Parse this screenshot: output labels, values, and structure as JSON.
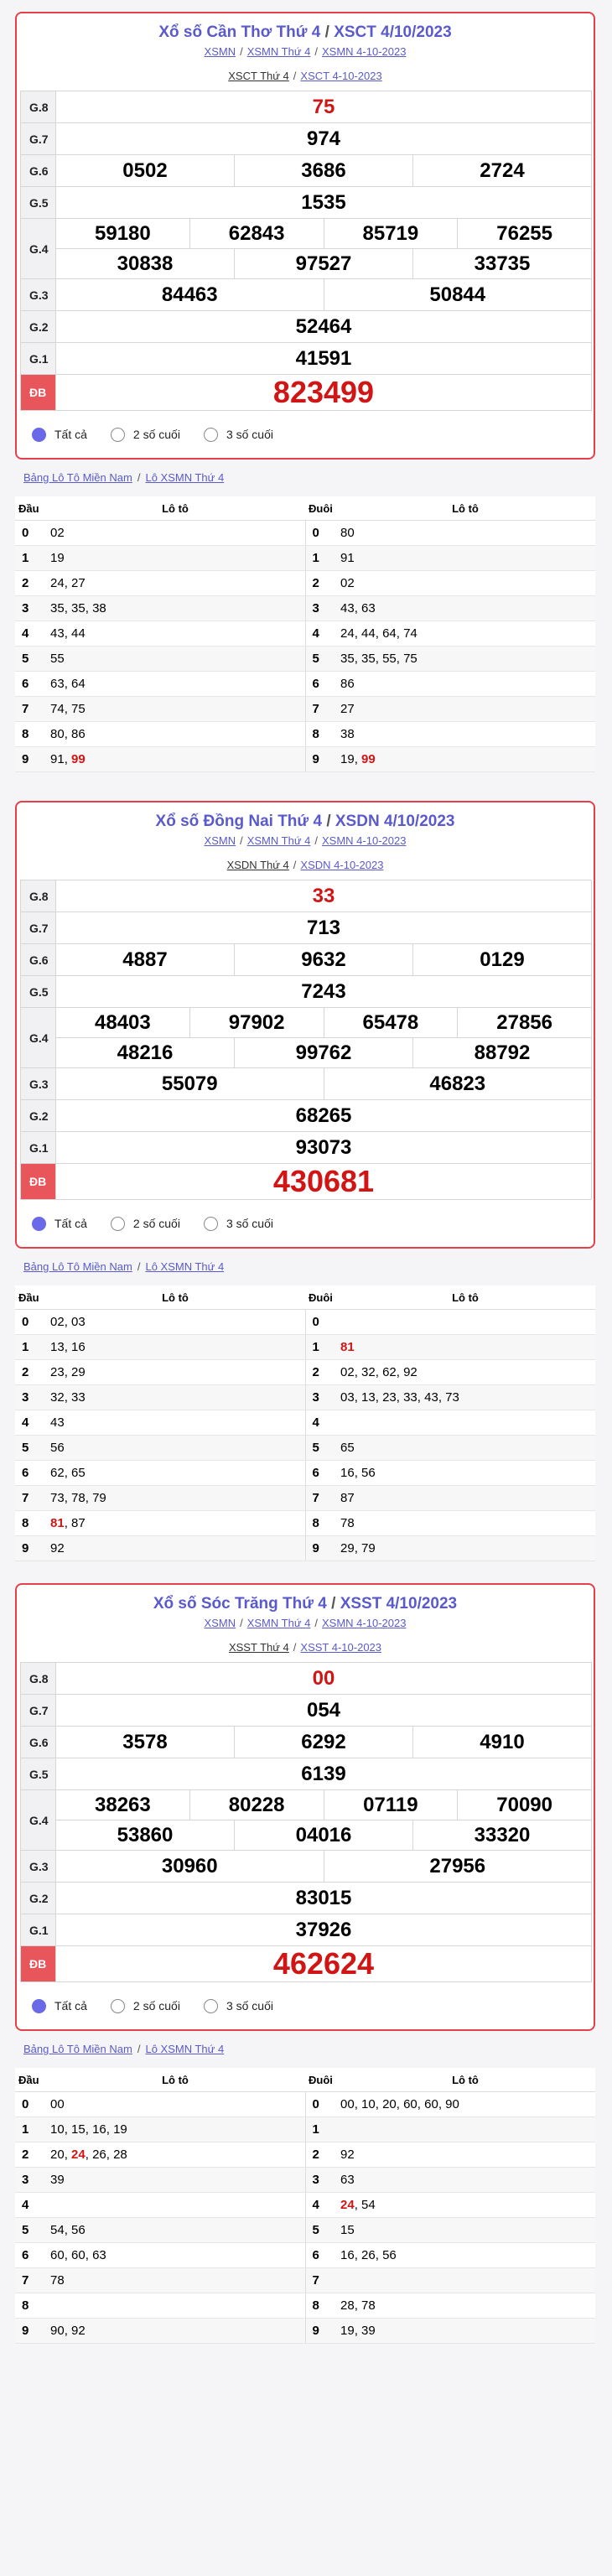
{
  "labels": {
    "prizes": [
      "G.8",
      "G.7",
      "G.6",
      "G.5",
      "G.4",
      "G.3",
      "G.2",
      "G.1",
      "ĐB"
    ],
    "options": [
      "Tất cả",
      "2 số cuối",
      "3 số cuối"
    ],
    "lo_head": [
      "Đầu",
      "Lô tô",
      "Đuôi",
      "Lô tô"
    ]
  },
  "sections": [
    {
      "title_main": "Xổ số Cần Thơ",
      "title_day": "Thứ 4",
      "title_code": "XSCT 4/10/2023",
      "links": [
        "XSMN",
        "XSMN Thứ 4",
        "XSMN 4-10-2023"
      ],
      "sublinks": [
        "XSCT Thứ 4",
        "XSCT 4-10-2023"
      ],
      "g8": "75",
      "g7": "974",
      "g6": [
        "0502",
        "3686",
        "2724"
      ],
      "g5": "1535",
      "g4": [
        "59180",
        "62843",
        "85719",
        "76255",
        "30838",
        "97527",
        "33735"
      ],
      "g3": [
        "84463",
        "50844"
      ],
      "g2": "52464",
      "g1": "41591",
      "db": "823499",
      "lo_links": [
        "Bảng Lô Tô Miền Nam",
        "Lô XSMN Thứ 4"
      ],
      "dau": [
        "02",
        "19",
        "24, 27",
        "35, 35, 38",
        "43, 44",
        "55",
        "63, 64",
        "74, 75",
        "80, 86",
        "91, 99"
      ],
      "duoi": [
        "80",
        "91",
        "02",
        "43, 63",
        "24, 44, 64, 74",
        "35, 35, 55, 75",
        "86",
        "27",
        "38",
        "19, 99"
      ]
    },
    {
      "title_main": "Xổ số Đồng Nai",
      "title_day": "Thứ 4",
      "title_code": "XSDN 4/10/2023",
      "links": [
        "XSMN",
        "XSMN Thứ 4",
        "XSMN 4-10-2023"
      ],
      "sublinks": [
        "XSDN Thứ 4",
        "XSDN 4-10-2023"
      ],
      "g8": "33",
      "g7": "713",
      "g6": [
        "4887",
        "9632",
        "0129"
      ],
      "g5": "7243",
      "g4": [
        "48403",
        "97902",
        "65478",
        "27856",
        "48216",
        "99762",
        "88792"
      ],
      "g3": [
        "55079",
        "46823"
      ],
      "g2": "68265",
      "g1": "93073",
      "db": "430681",
      "lo_links": [
        "Bảng Lô Tô Miền Nam",
        "Lô XSMN Thứ 4"
      ],
      "dau": [
        "02, 03",
        "13, 16",
        "23, 29",
        "32, 33",
        "43",
        "56",
        "62, 65",
        "73, 78, 79",
        "81, 87",
        "92"
      ],
      "duoi": [
        "",
        "81",
        "02, 32, 62, 92",
        "03, 13, 23, 33, 43, 73",
        "",
        "65",
        "16, 56",
        "87",
        "78",
        "29, 79"
      ]
    },
    {
      "title_main": "Xổ số Sóc Trăng",
      "title_day": "Thứ 4",
      "title_code": "XSST 4/10/2023",
      "links": [
        "XSMN",
        "XSMN Thứ 4",
        "XSMN 4-10-2023"
      ],
      "sublinks": [
        "XSST Thứ 4",
        "XSST 4-10-2023"
      ],
      "g8": "00",
      "g7": "054",
      "g6": [
        "3578",
        "6292",
        "4910"
      ],
      "g5": "6139",
      "g4": [
        "38263",
        "80228",
        "07119",
        "70090",
        "53860",
        "04016",
        "33320"
      ],
      "g3": [
        "30960",
        "27956"
      ],
      "g2": "83015",
      "g1": "37926",
      "db": "462624",
      "lo_links": [
        "Bảng Lô Tô Miền Nam",
        "Lô XSMN Thứ 4"
      ],
      "dau": [
        "00",
        "10, 15, 16, 19",
        "20, 24, 26, 28",
        "39",
        "",
        "54, 56",
        "60, 60, 63",
        "78",
        "",
        "90, 92"
      ],
      "duoi": [
        "00, 10, 20, 60, 60, 90",
        "",
        "92",
        "63",
        "24, 54",
        "15",
        "16, 26, 56",
        "",
        "28, 78",
        "19, 39"
      ]
    }
  ],
  "colors": {
    "accent": "#5a5acc",
    "red": "#d11515",
    "border": "#e4404a"
  }
}
